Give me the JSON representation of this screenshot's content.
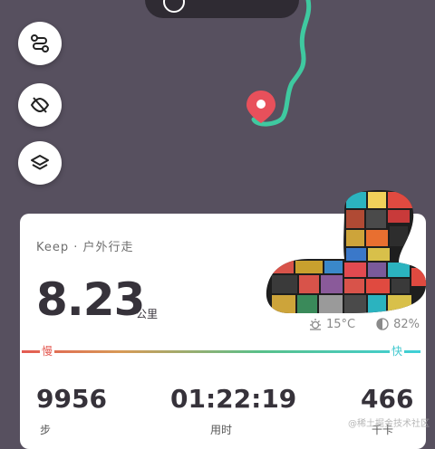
{
  "card": {
    "brand": "Keep · 户外行走",
    "distance": "8.23",
    "distance_unit": "公里",
    "temperature": "15°C",
    "humidity": "82%",
    "pace_slow": "慢",
    "pace_fast": "快"
  },
  "stats": [
    {
      "value": "9956",
      "unit": "步"
    },
    {
      "value": "01:22:19",
      "unit": "用时"
    },
    {
      "value": "466",
      "unit": "千卡"
    }
  ],
  "map_buttons": [
    "route-icon",
    "hide-icon",
    "layers-icon"
  ],
  "colors": {
    "route": "#3fc9a0",
    "marker": "#e8505b",
    "background": "#57505f"
  },
  "watermark": "@稀土掘金技术社区"
}
